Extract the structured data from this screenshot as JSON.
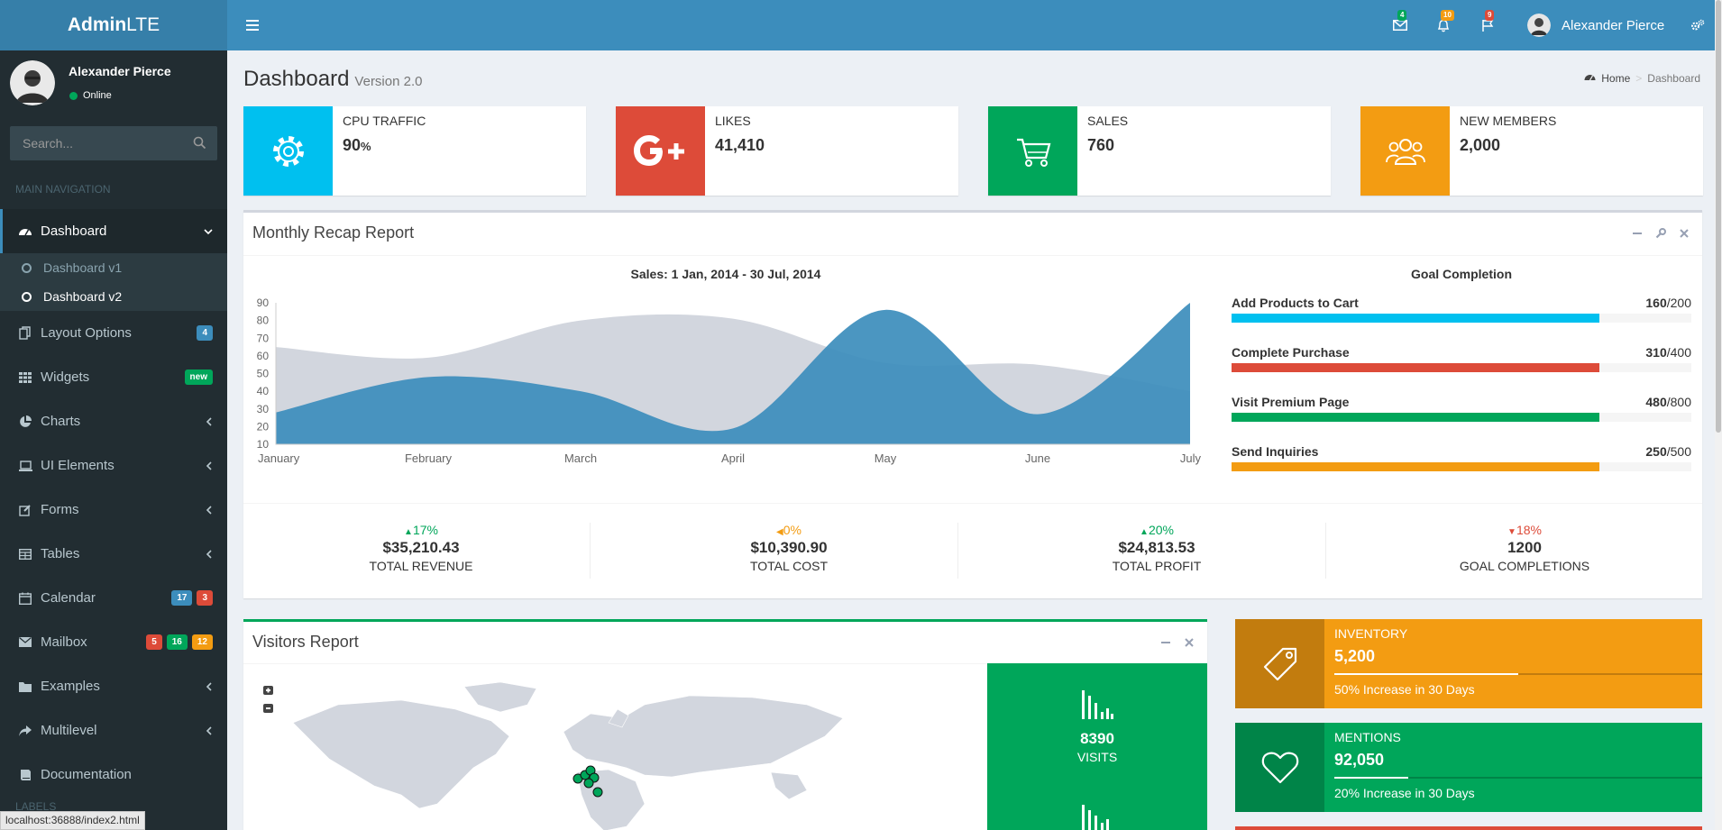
{
  "app": {
    "logo_bold": "Admin",
    "logo_rest": "LTE",
    "user_name": "Alexander Pierce",
    "status_url": "localhost:36888/index2.html"
  },
  "navbar": {
    "badges": {
      "messages": "4",
      "notifications": "10",
      "tasks": "9"
    },
    "user_name": "Alexander Pierce"
  },
  "sidebar": {
    "user_name": "Alexander Pierce",
    "user_status": "Online",
    "search_placeholder": "Search...",
    "header": "MAIN NAVIGATION",
    "footer_header": "LABELS",
    "items": [
      {
        "label": "Dashboard"
      },
      {
        "label": "Layout Options",
        "badges": [
          "4"
        ]
      },
      {
        "label": "Widgets",
        "badges": [
          "new"
        ]
      },
      {
        "label": "Charts"
      },
      {
        "label": "UI Elements"
      },
      {
        "label": "Forms"
      },
      {
        "label": "Tables"
      },
      {
        "label": "Calendar",
        "badges": [
          "17",
          "3"
        ]
      },
      {
        "label": "Mailbox",
        "badges": [
          "5",
          "16",
          "12"
        ]
      },
      {
        "label": "Examples"
      },
      {
        "label": "Multilevel"
      },
      {
        "label": "Documentation"
      }
    ],
    "subitems": [
      {
        "label": "Dashboard v1"
      },
      {
        "label": "Dashboard v2"
      }
    ]
  },
  "page": {
    "title": "Dashboard",
    "subtitle": "Version 2.0",
    "breadcrumb_home": "Home",
    "breadcrumb_current": "Dashboard"
  },
  "info_boxes": [
    {
      "text": "CPU TRAFFIC",
      "number": "90",
      "unit": "%",
      "color": "#00c0ef",
      "icon": "gear-icon"
    },
    {
      "text": "LIKES",
      "number": "41,410",
      "color": "#dd4b39",
      "icon": "google-plus-icon"
    },
    {
      "text": "SALES",
      "number": "760",
      "color": "#00a65a",
      "icon": "shopping-cart-icon"
    },
    {
      "text": "NEW MEMBERS",
      "number": "2,000",
      "color": "#f39c12",
      "icon": "users-icon"
    }
  ],
  "recap": {
    "title": "Monthly Recap Report",
    "chart_title": "Sales: 1 Jan, 2014 - 30 Jul, 2014",
    "goal_title": "Goal Completion",
    "goals": [
      {
        "label": "Add Products to Cart",
        "value": "160",
        "total": "/200",
        "fraction": 0.8,
        "color": "#00c0ef"
      },
      {
        "label": "Complete Purchase",
        "value": "310",
        "total": "/400",
        "fraction": 0.8,
        "color": "#dd4b39"
      },
      {
        "label": "Visit Premium Page",
        "value": "480",
        "total": "/800",
        "fraction": 0.8,
        "color": "#00a65a"
      },
      {
        "label": "Send Inquiries",
        "value": "250",
        "total": "/500",
        "fraction": 0.8,
        "color": "#f39c12"
      }
    ],
    "stats": [
      {
        "pct": "17%",
        "dir": "up",
        "amount": "$35,210.43",
        "label": "TOTAL REVENUE",
        "color": "#00a65a"
      },
      {
        "pct": "0%",
        "dir": "left",
        "amount": "$10,390.90",
        "label": "TOTAL COST",
        "color": "#f39c12"
      },
      {
        "pct": "20%",
        "dir": "up",
        "amount": "$24,813.53",
        "label": "TOTAL PROFIT",
        "color": "#00a65a"
      },
      {
        "pct": "18%",
        "dir": "down",
        "amount": "1200",
        "label": "GOAL COMPLETIONS",
        "color": "#dd4b39"
      }
    ]
  },
  "visitors": {
    "title": "Visitors Report",
    "visits_number": "8390",
    "visits_label": "VISITS"
  },
  "side_boxes": [
    {
      "text": "INVENTORY",
      "number": "5,200",
      "desc": "50% Increase in 30 Days",
      "progress": 0.5,
      "color": "#f39c12",
      "icon": "tag-icon"
    },
    {
      "text": "MENTIONS",
      "number": "92,050",
      "desc": "20% Increase in 30 Days",
      "progress": 0.2,
      "color": "#00a65a",
      "icon": "heart-icon"
    }
  ],
  "chart_data": {
    "type": "area",
    "title": "Sales: 1 Jan, 2014 - 30 Jul, 2014",
    "categories": [
      "January",
      "February",
      "March",
      "April",
      "May",
      "June",
      "July"
    ],
    "ylim": [
      10,
      90
    ],
    "yticks": [
      10,
      20,
      30,
      40,
      50,
      60,
      70,
      80,
      90
    ],
    "grid": false,
    "series": [
      {
        "values": [
          65,
          59,
          80,
          81,
          56,
          55,
          40
        ],
        "color": "#d2d6de"
      },
      {
        "values": [
          28,
          48,
          40,
          19,
          86,
          27,
          90
        ],
        "color": "#3c8dbc"
      }
    ]
  }
}
